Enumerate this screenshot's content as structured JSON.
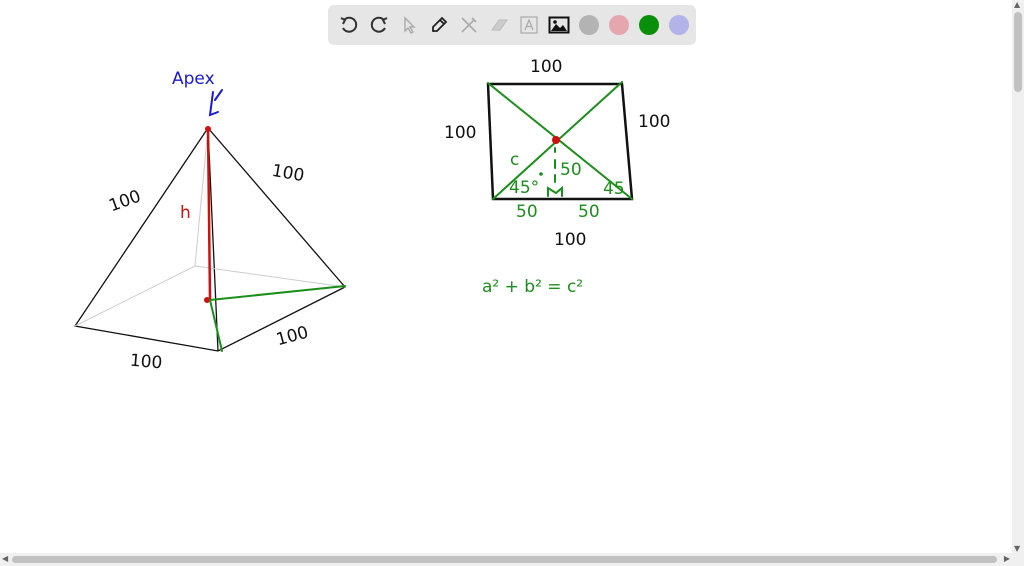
{
  "toolbar": {
    "tools": [
      "undo",
      "redo",
      "select",
      "pen",
      "tools",
      "eraser",
      "text",
      "image"
    ],
    "colors": [
      {
        "name": "gray",
        "hex": "#b3b3b3"
      },
      {
        "name": "pink",
        "hex": "#e6a6ad"
      },
      {
        "name": "green",
        "hex": "#0a8f0a",
        "selected": true
      },
      {
        "name": "lavender",
        "hex": "#b3b3ea"
      }
    ]
  },
  "drawing": {
    "apex_label": "Apex",
    "height_label": "h",
    "pyramid_edge_left": "100",
    "pyramid_edge_right": "100",
    "pyramid_base_front": "100",
    "pyramid_base_right": "100",
    "square_top": "100",
    "square_left": "100",
    "square_right": "100",
    "square_bottom": "100",
    "hyp_label": "c",
    "half_left": "50",
    "half_right": "50",
    "vertical_half": "50",
    "angle_left": "45°",
    "angle_right": "45",
    "formula": "a² + b² = c²",
    "colors": {
      "black": "#111111",
      "green": "#1a8f1a",
      "red": "#d01010",
      "blue": "#1a1ad0"
    }
  }
}
